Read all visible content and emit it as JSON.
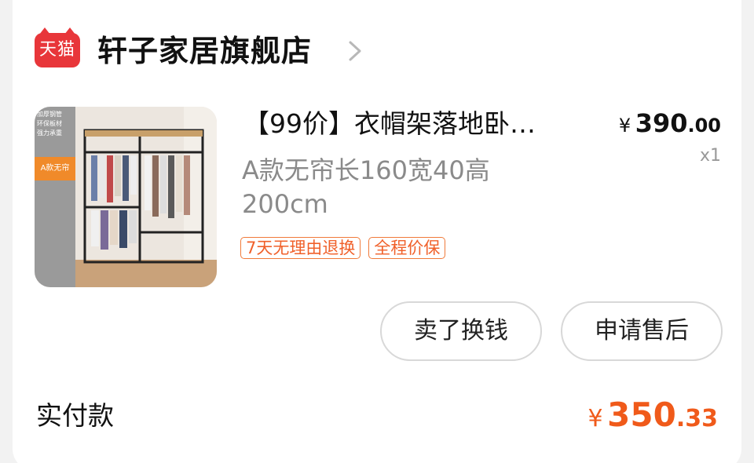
{
  "store": {
    "logo_text": "天猫",
    "name": "轩子家居旗舰店"
  },
  "product": {
    "image_alt": "product-image",
    "image_side_text": [
      "加厚钢管",
      "环保板材",
      "强力承重"
    ],
    "image_tag": "A款无帘",
    "title": "【99价】衣帽架落地卧…",
    "spec": "A款无帘长160宽40高200cm",
    "badges": [
      "7天无理由退换",
      "全程价保"
    ],
    "price_currency": "¥",
    "price_integer": "390",
    "price_decimal": ".00",
    "quantity": "x1"
  },
  "actions": {
    "sell_label": "卖了换钱",
    "aftersale_label": "申请售后"
  },
  "payment": {
    "label": "实付款",
    "currency": "¥",
    "amount_integer": "350",
    "amount_decimal": ".33"
  },
  "colors": {
    "brand_red": "#e8363a",
    "accent_orange": "#f05a1a"
  }
}
